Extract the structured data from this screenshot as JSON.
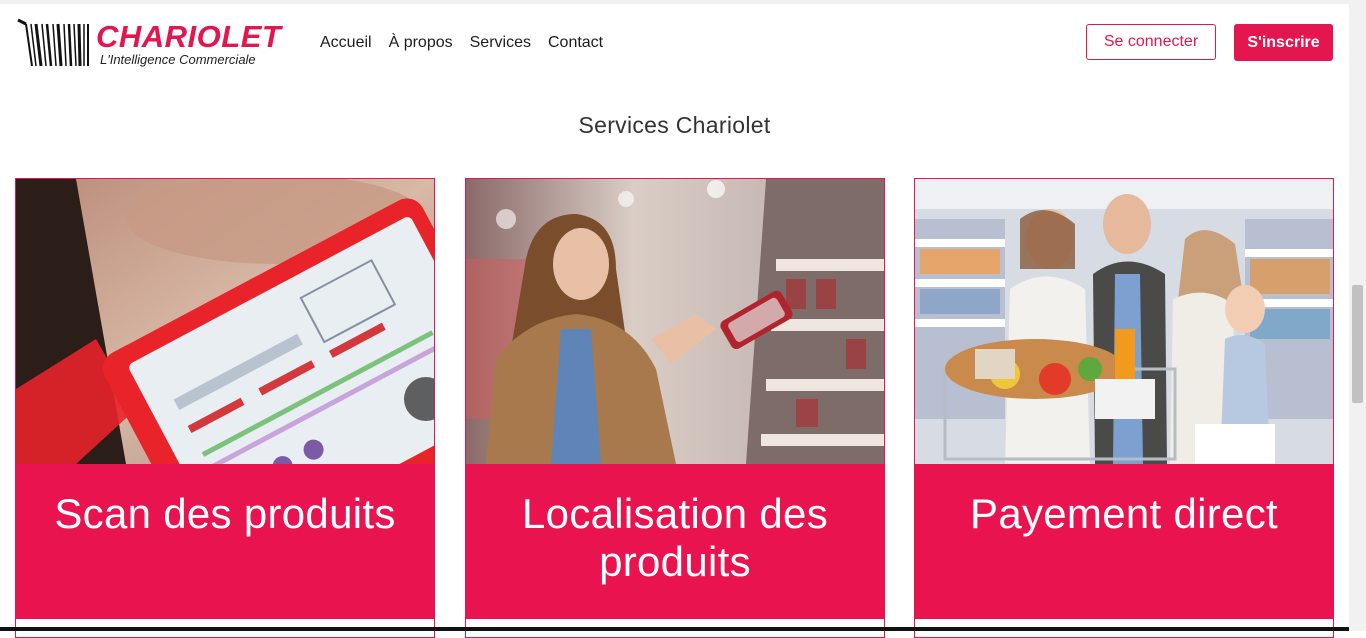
{
  "brand": {
    "name": "CHARIOLET",
    "tagline": "L'Intelligence Commerciale",
    "color": "#e3164f"
  },
  "nav": {
    "items": [
      "Accueil",
      "À propos",
      "Services",
      "Contact"
    ]
  },
  "auth": {
    "login_label": "Se connecter",
    "signup_label": "S'inscrire"
  },
  "services": {
    "title": "Services Chariolet",
    "cards": [
      {
        "label": "Scan des produits",
        "image": "tablet-scan-photo"
      },
      {
        "label": "Localisation des produits",
        "image": "woman-shopping-photo"
      },
      {
        "label": "Payement direct",
        "image": "family-cart-photo"
      }
    ]
  }
}
